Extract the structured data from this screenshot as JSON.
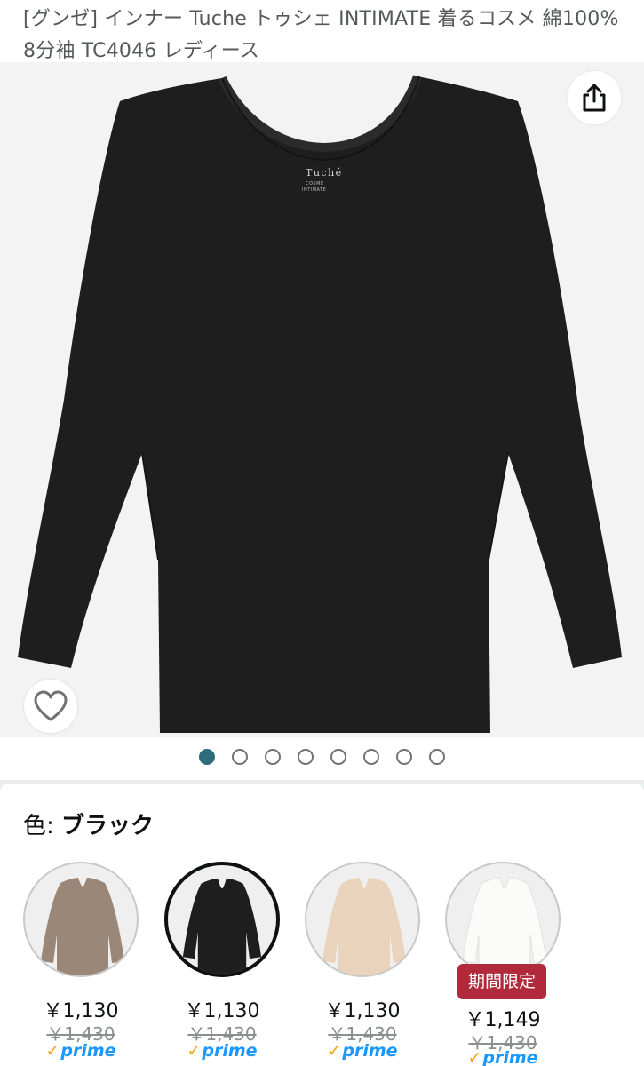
{
  "product": {
    "title": "[グンゼ] インナー Tuche トゥシェ INTIMATE 着るコスメ 綿100% 8分袖 TC4046 レディース",
    "garment_label": {
      "brand": "Tuché",
      "line1": "COSME",
      "line2": "INTIMATE"
    }
  },
  "gallery": {
    "image_count": 8,
    "active_index": 0,
    "share_icon": "share-icon",
    "favorite_icon": "heart-outline-icon"
  },
  "color_selector": {
    "label": "色:",
    "selected_value": "ブラック",
    "options": [
      {
        "name": "mocha",
        "color": "#9a8777",
        "price": "￥1,130",
        "list_price": "￥1,430",
        "prime": "prime",
        "selected": false
      },
      {
        "name": "black",
        "color": "#1e1e1e",
        "price": "￥1,130",
        "list_price": "￥1,430",
        "prime": "prime",
        "selected": true
      },
      {
        "name": "beige",
        "color": "#e9d3bd",
        "price": "￥1,130",
        "list_price": "￥1,430",
        "prime": "prime",
        "selected": false
      },
      {
        "name": "white",
        "color": "#fbfbfa",
        "price": "￥1,149",
        "list_price": "￥1,430",
        "prime": "prime",
        "selected": false,
        "badge": "期間限定"
      }
    ]
  },
  "colors": {
    "hero_bg": "#f3f3f3",
    "dot_active": "#2e6b7b",
    "badge": "#b12a3c",
    "prime_blue": "#1a98ff",
    "prime_check": "#f7a21b"
  }
}
